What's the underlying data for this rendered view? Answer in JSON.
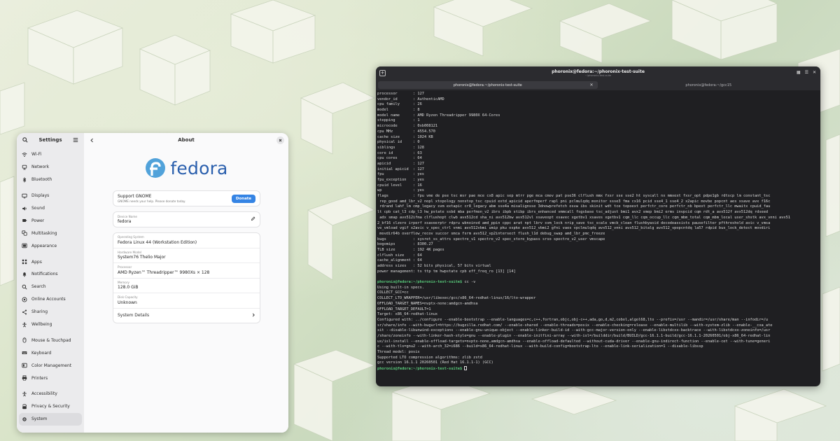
{
  "colors": {
    "accent": "#3584e4",
    "fedora_blue": "#2a5fad",
    "terminal_bg": "#1f1f22",
    "prompt_green": "#58c97a"
  },
  "settings": {
    "sidebar_title": "Settings",
    "items": [
      {
        "label": "Wi-Fi",
        "icon": "wifi-icon",
        "gap_before": false,
        "active": false
      },
      {
        "label": "Network",
        "icon": "network-icon",
        "gap_before": false,
        "active": false
      },
      {
        "label": "Bluetooth",
        "icon": "bluetooth-icon",
        "gap_before": false,
        "active": false
      },
      {
        "label": "Displays",
        "icon": "display-icon",
        "gap_before": true,
        "active": false
      },
      {
        "label": "Sound",
        "icon": "sound-icon",
        "gap_before": false,
        "active": false
      },
      {
        "label": "Power",
        "icon": "power-icon",
        "gap_before": false,
        "active": false
      },
      {
        "label": "Multitasking",
        "icon": "multitasking-icon",
        "gap_before": false,
        "active": false
      },
      {
        "label": "Appearance",
        "icon": "appearance-icon",
        "gap_before": false,
        "active": false
      },
      {
        "label": "Apps",
        "icon": "apps-icon",
        "gap_before": true,
        "active": false
      },
      {
        "label": "Notifications",
        "icon": "bell-icon",
        "gap_before": false,
        "active": false
      },
      {
        "label": "Search",
        "icon": "search-icon",
        "gap_before": false,
        "active": false
      },
      {
        "label": "Online Accounts",
        "icon": "online-accounts-icon",
        "gap_before": false,
        "active": false
      },
      {
        "label": "Sharing",
        "icon": "share-icon",
        "gap_before": false,
        "active": false
      },
      {
        "label": "Wellbeing",
        "icon": "wellbeing-icon",
        "gap_before": false,
        "active": false
      },
      {
        "label": "Mouse & Touchpad",
        "icon": "mouse-icon",
        "gap_before": true,
        "active": false
      },
      {
        "label": "Keyboard",
        "icon": "keyboard-icon",
        "gap_before": false,
        "active": false
      },
      {
        "label": "Color Management",
        "icon": "color-icon",
        "gap_before": false,
        "active": false
      },
      {
        "label": "Printers",
        "icon": "printer-icon",
        "gap_before": false,
        "active": false
      },
      {
        "label": "Accessibility",
        "icon": "accessibility-icon",
        "gap_before": true,
        "active": false
      },
      {
        "label": "Privacy & Security",
        "icon": "privacy-icon",
        "gap_before": false,
        "active": false
      },
      {
        "label": "System",
        "icon": "system-icon",
        "gap_before": false,
        "active": true
      }
    ],
    "about": {
      "title": "About",
      "logo_text": "fedora",
      "support_title": "Support GNOME",
      "support_subtitle": "GNOME needs your help. Please donate today.",
      "donate_label": "Donate",
      "device_name_caption": "Device Name",
      "device_name": "fedora",
      "rows": [
        {
          "caption": "Operating System",
          "value": "Fedora Linux 44 (Workstation Edition)"
        },
        {
          "caption": "Hardware Model",
          "value": "System76 Thelio Major"
        },
        {
          "caption": "Processor",
          "value": "AMD Ryzen™ Threadripper™ 9980Xs × 128"
        },
        {
          "caption": "Memory",
          "value": "128.0 GiB"
        },
        {
          "caption": "Disk Capacity",
          "value": "Unknown"
        }
      ],
      "system_details_label": "System Details"
    }
  },
  "terminal": {
    "title": "phoronix@fedora:~/phoronix-test-suite",
    "subtitle": "~/phoronix-test-suite",
    "tabs": [
      {
        "label": "phoronix@fedora:~/phoronix-test-suite",
        "active": true
      },
      {
        "label": "phoronix@fedora:~/gcc15",
        "active": false
      }
    ],
    "lines": [
      {
        "text": "processor       : 127"
      },
      {
        "text": "vendor_id       : AuthenticAMD"
      },
      {
        "text": "cpu family      : 26"
      },
      {
        "text": "model           : 8"
      },
      {
        "text": "model name      : AMD Ryzen Threadripper 9980X 64-Cores"
      },
      {
        "text": "stepping        : 1"
      },
      {
        "text": "microcode       : 0xb008121"
      },
      {
        "text": "cpu MHz         : 4554.570"
      },
      {
        "text": "cache size      : 1024 KB"
      },
      {
        "text": "physical id     : 0"
      },
      {
        "text": "siblings        : 128"
      },
      {
        "text": "core id         : 63"
      },
      {
        "text": "cpu cores       : 64"
      },
      {
        "text": "apicid          : 127"
      },
      {
        "text": "initial apicid  : 127"
      },
      {
        "text": "fpu             : yes"
      },
      {
        "text": "fpu_exception   : yes"
      },
      {
        "text": "cpuid level     : 16"
      },
      {
        "text": "wp              : yes"
      },
      {
        "text": "flags           : fpu vme de pse tsc msr pae mce cx8 apic sep mtrr pge mca cmov pat pse36 clflush mmx fxsr sse sse2 ht syscall nx mmxext fxsr_opt pdpe1gb rdtscp lm constant_tsc"
      },
      {
        "text": " rep_good amd_lbr_v2 nopl xtopology nonstop_tsc cpuid extd_apicid aperfmperf rapl pni pclmulqdq monitor ssse3 fma cx16 pcid sse4_1 sse4_2 x2apic movbe popcnt aes xsave avx f16c"
      },
      {
        "text": " rdrand lahf_lm cmp_legacy svm extapic cr8_legacy abm sse4a misalignsse 3dnowprefetch osvw ibs skinit wdt tce topoext perfctr_core perfctr_nb bpext perfctr_llc mwaitx cpuid_fau"
      },
      {
        "text": "lt cpb cat_l3 cdp_l3 hw_pstate ssbd mba perfmon_v2 ibrs ibpb stibp ibrs_enhanced vmmcall fsgsbase tsc_adjust bmi1 avx2 smep bmi2 erms invpcid cqm rdt_a avx512f avx512dq rdseed"
      },
      {
        "text": " adx smap avx512ifma clflushopt clwb avx512cd sha_ni avx512bw avx512vl xsaveopt xsavec xgetbv1 xsaves xgetbv1 cqm_llc cqm_occup_llc cqm_mbm_total cqm_mbm_local user_shstk avx_vnni avx51"
      },
      {
        "text": "2_bf16 clzero irperf xsaveerptr rdpru wbnoinvd amd_ppin cppc arat npt lbrv svm_lock nrip_save tsc_scale vmcb_clean flushbyasid decodeassists pausefilter pfthreshold avic v_vmsa"
      },
      {
        "text": "ve_vmload vgif x2avic v_spec_ctrl vnmi avx512vbmi umip pku ospke avx512_vbmi2 gfni vaes vpclmulqdq avx512_vnni avx512_bitalg avx512_vpopcntdq la57 rdpid bus_lock_detect movdiri"
      },
      {
        "text": " movdir64b overflow_recov succor smca fsrm avx512_vp2intersect flush_l1d debug_swap amd_lbr_pmc_freeze"
      },
      {
        "text": "bugs            : sysret_ss_attrs spectre_v1 spectre_v2 spec_store_bypass srso spectre_v2_user vmscape"
      },
      {
        "text": "bogomips        : 8300.27"
      },
      {
        "text": "TLB size        : 192 4K pages"
      },
      {
        "text": "clflush size    : 64"
      },
      {
        "text": "cache_alignment : 64"
      },
      {
        "text": "address sizes   : 52 bits physical, 57 bits virtual"
      },
      {
        "text": "power management: ts ttp tm hwpstate cpb eff_freq_ro [13] [14]"
      },
      {
        "text": ""
      },
      {
        "prompt": "phoronix@fedora:~/phoronix-test-suite$",
        "text": " cc -v"
      },
      {
        "text": "Using built-in specs."
      },
      {
        "text": "COLLECT_GCC=cc"
      },
      {
        "text": "COLLECT_LTO_WRAPPER=/usr/libexec/gcc/x86_64-redhat-linux/16/lto-wrapper"
      },
      {
        "text": "OFFLOAD_TARGET_NAMES=nvptx-none:amdgcn-amdhsa"
      },
      {
        "text": "OFFLOAD_TARGET_DEFAULT=1"
      },
      {
        "text": "Target: x86_64-redhat-linux"
      },
      {
        "text": "Configured with: ../configure --enable-bootstrap --enable-languages=c,c++,fortran,objc,obj-c++,ada,go,d,m2,cobol,algol68,lto --prefix=/usr --mandir=/usr/share/man --infodir=/u"
      },
      {
        "text": "sr/share/info --with-bugurl=https://bugzilla.redhat.com/ --enable-shared --enable-threads=posix --enable-checking=release --enable-multilib --with-system-zlib --enable-__cxa_ate"
      },
      {
        "text": "xit --disable-libunwind-exceptions --enable-gnu-unique-object --enable-linker-build-id --with-gcc-major-version-only --enable-libstdcxx-backtrace --with-libstdcxx-zoneinfo=/usr"
      },
      {
        "text": "/share/zoneinfo --with-linker-hash-style=gnu --enable-plugin --enable-initfini-array --with-isl=/builddir/build/BUILD/gcc-16.1.1-build/gcc-16.1.1-20260501/obj-x86_64-redhat-lin"
      },
      {
        "text": "ux/isl-install --enable-offload-targets=nvptx-none,amdgcn-amdhsa --enable-offload-defaulted --without-cuda-driver --enable-gnu-indirect-function --enable-cet --with-tune=generi"
      },
      {
        "text": "c --with-tls=gnu2 --with-arch_32=i686 --build=x86_64-redhat-linux --with-build-config=bootstrap-lto --enable-link-serialization=1 --disable-libssp"
      },
      {
        "text": "Thread model: posix"
      },
      {
        "text": "Supported LTO compression algorithms: zlib zstd"
      },
      {
        "text": "gcc version 16.1.1 20260501 (Red Hat 16.1.1-1) (GCC)"
      },
      {
        "prompt": "phoronix@fedora:~/phoronix-test-suite$",
        "text": " ",
        "cursor": true
      }
    ]
  }
}
